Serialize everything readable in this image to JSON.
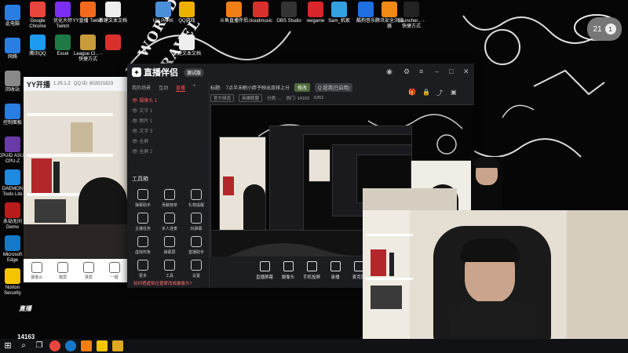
{
  "desktop": {
    "doodle_text": [
      "WORLD",
      "TRAVEL"
    ],
    "icons_left": [
      {
        "label": "此电脑",
        "color": "#2a7de1",
        "icon": "computer-icon"
      },
      {
        "label": "网络",
        "color": "#2a7de1",
        "icon": "network-icon"
      },
      {
        "label": "回收站",
        "color": "#8a8a8a",
        "icon": "recycle-bin-icon"
      },
      {
        "label": "控制面板",
        "color": "#2a7de1",
        "icon": "control-panel-icon"
      },
      {
        "label": "CPUID ASUS CPU-Z",
        "color": "#6a3aa8",
        "icon": "cpu-z-icon"
      },
      {
        "label": "DAEMON Tools Lite",
        "color": "#1f8be0",
        "icon": "daemon-tools-icon"
      },
      {
        "label": "永劫无间 Demo",
        "color": "#b81c1c",
        "icon": "game-icon"
      },
      {
        "label": "Microsoft Edge",
        "color": "#1579c8",
        "icon": "edge-icon"
      },
      {
        "label": "Norton Security",
        "color": "#f5c400",
        "icon": "norton-icon"
      }
    ],
    "icons_top": [
      {
        "label": "Google Chrome",
        "color": "#e8453c",
        "icon": "chrome-icon"
      },
      {
        "label": "优化大师 Twitch",
        "color": "#7d2ef5",
        "icon": "app-icon"
      },
      {
        "label": "YY直播 Twitch",
        "color": "#f26b1d",
        "icon": "app-icon"
      },
      {
        "label": "新建文本文档",
        "color": "#eeeeee",
        "icon": "text-file-icon"
      },
      {
        "label": "UU PARK",
        "color": "#4a90d9",
        "icon": "app-icon"
      },
      {
        "label": "QQ游戏",
        "color": "#f0b000",
        "icon": "qq-game-icon"
      },
      {
        "label": "斗鱼直播伴侣",
        "color": "#f07f16",
        "icon": "douyu-icon"
      },
      {
        "label": "cloudmusic",
        "color": "#d8312d",
        "icon": "music-icon"
      },
      {
        "label": "OBS Studio",
        "color": "#333333",
        "icon": "obs-icon"
      },
      {
        "label": "wegame",
        "color": "#d9242a",
        "icon": "wegame-icon"
      },
      {
        "label": "Sam_机家",
        "color": "#34a1e0",
        "icon": "app-icon"
      },
      {
        "label": "酷狗音乐",
        "color": "#1e6fe0",
        "icon": "kugou-icon"
      },
      {
        "label": "腾讯安全浏览器",
        "color": "#f08a17",
        "icon": "browser-icon"
      },
      {
        "label": "Launcher... - 快捷方式",
        "color": "#222222",
        "icon": "launcher-icon"
      }
    ],
    "icons_row2": [
      {
        "label": "腾讯QQ",
        "color": "#1d9bf0",
        "icon": "qq-icon"
      },
      {
        "label": "Excel",
        "color": "#1d7a45",
        "icon": "excel-icon"
      },
      {
        "label": "League Cl... - 快捷方式",
        "color": "#c89b3c",
        "icon": "league-icon"
      },
      {
        "label": "",
        "color": "#d8312d",
        "icon": "app-icon"
      },
      {
        "label": "新建文本文档",
        "color": "#eeeeee",
        "icon": "text-file-icon"
      }
    ],
    "clock_widget": {
      "time": "21",
      "day": "1"
    }
  },
  "yy_window": {
    "app_name": "YY开播",
    "version": "1.29.1.2",
    "qq_id": "QQ ID: 802021823",
    "buttons": [
      "摄像头",
      "截屏",
      "录屏",
      "一键"
    ]
  },
  "studio": {
    "app_name": "直播伴侣",
    "version": "测试版",
    "tabs": [
      "我的场景",
      "互动",
      "直播",
      "+"
    ],
    "active_tab": "直播",
    "scene_label": "场景",
    "sources": [
      {
        "name": "摄像头 1",
        "selected": true
      },
      {
        "name": "文字 1",
        "selected": false
      },
      {
        "name": "图片 1",
        "selected": false
      },
      {
        "name": "文字 3",
        "selected": false
      },
      {
        "name": "全屏",
        "selected": false
      },
      {
        "name": "全屏 2",
        "selected": false
      }
    ],
    "toolbox_title": "工具箱",
    "tools": [
      {
        "label": "弹幕助手"
      },
      {
        "label": "贡献榜单"
      },
      {
        "label": "礼物提醒"
      },
      {
        "label": "主播任务"
      },
      {
        "label": "多人连麦"
      },
      {
        "label": "玩弹幕"
      },
      {
        "label": "虚拟形象"
      },
      {
        "label": "弹幕屏"
      },
      {
        "label": "直播助手"
      },
      {
        "label": "更多"
      },
      {
        "label": "工具"
      },
      {
        "label": "设置"
      }
    ],
    "notice": "如何把虚拟位置更改成摄像头?",
    "info": {
      "title_label": "标题:",
      "title": "7点半未眠小胖子映出双排上分",
      "edit": "修改",
      "room": "房间号: 14163",
      "hot": "🔥 6361",
      "status": "Q 超清(已启用)"
    },
    "row2": [
      "官方频道",
      "英雄联盟",
      "分类: ...",
      "热门: 14163",
      "6361"
    ],
    "controls": [
      "直播屏幕",
      "摄像头",
      "手机投屏",
      "录播",
      "麦克风"
    ]
  },
  "overlay": {
    "live_badge": "直播",
    "room_number": "14163"
  },
  "taskbar": {
    "items": [
      "开始",
      "搜索",
      "任务视图",
      "Chrome",
      "Edge",
      "直播伴侣",
      "YY",
      "文件"
    ]
  }
}
